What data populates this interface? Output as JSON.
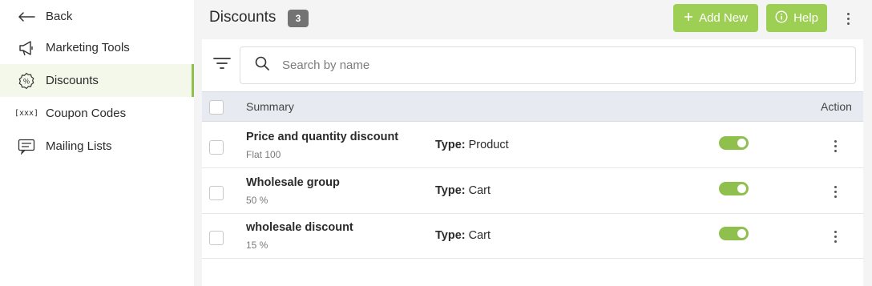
{
  "sidebar": {
    "items": [
      {
        "label": "Back",
        "icon": "arrow-left-icon"
      },
      {
        "label": "Marketing Tools",
        "icon": "megaphone-icon"
      },
      {
        "label": "Discounts",
        "icon": "percent-badge-icon",
        "active": true
      },
      {
        "label": "Coupon Codes",
        "icon": "coupon-code-icon",
        "icon_text": "[xxx]"
      },
      {
        "label": "Mailing Lists",
        "icon": "mail-list-icon"
      }
    ]
  },
  "header": {
    "title": "Discounts",
    "count": "3",
    "add_label": "Add New",
    "help_label": "Help"
  },
  "search": {
    "placeholder": "Search by name"
  },
  "table": {
    "columns": {
      "summary": "Summary",
      "action": "Action"
    },
    "type_label": "Type:",
    "rows": [
      {
        "title": "Price and quantity discount",
        "subtitle": "Flat 100",
        "type": "Product",
        "enabled": true
      },
      {
        "title": "Wholesale group",
        "subtitle": "50 %",
        "type": "Cart",
        "enabled": true
      },
      {
        "title": "wholesale discount",
        "subtitle": "15 %",
        "type": "Cart",
        "enabled": true
      }
    ]
  },
  "colors": {
    "accent_green": "#9ecf55",
    "toggle_green": "#8fc04e",
    "badge_gray": "#737373",
    "header_row": "#e7ebf1"
  }
}
